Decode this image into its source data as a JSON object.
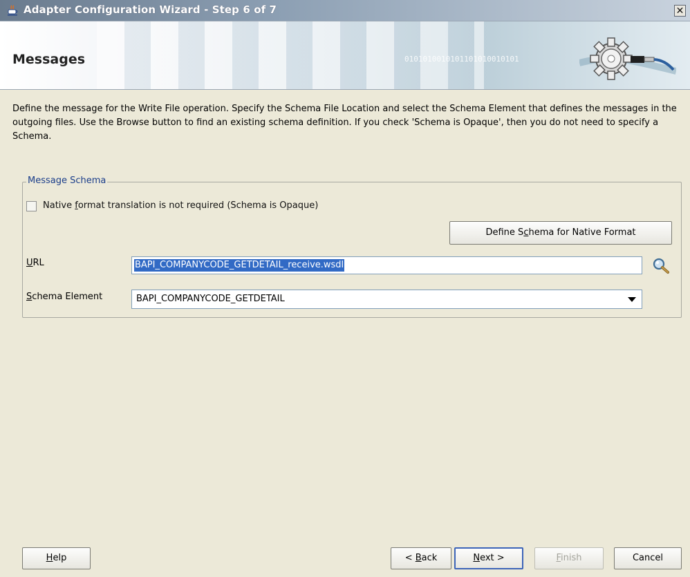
{
  "window": {
    "title": "Adapter Configuration Wizard - Step 6 of 7",
    "close_label": "✕"
  },
  "banner": {
    "heading": "Messages",
    "binary_text": "0101010010101101010010101"
  },
  "description": "Define the message for the Write File operation.  Specify the Schema File Location and select the Schema Element that defines the messages in the outgoing files. Use the Browse button to find an existing schema definition. If you check 'Schema is Opaque', then you do not need to specify a Schema.",
  "message_schema": {
    "group_title": "Message Schema",
    "opaque_checkbox": {
      "label_prefix": "Native ",
      "label_mnemonic": "f",
      "label_suffix": "ormat translation is not required (Schema is Opaque)",
      "checked": false
    },
    "define_button": {
      "label_prefix": "Define S",
      "label_mnemonic": "c",
      "label_suffix": "hema for Native Format"
    },
    "url": {
      "label_mnemonic": "U",
      "label_suffix": "RL",
      "value": "BAPI_COMPANYCODE_GETDETAIL_receive.wsdl"
    },
    "schema_element": {
      "label_mnemonic": "S",
      "label_suffix": "chema Element",
      "value": "BAPI_COMPANYCODE_GETDETAIL"
    }
  },
  "buttons": {
    "help": {
      "mnemonic": "H",
      "suffix": "elp"
    },
    "back": {
      "prefix": "< ",
      "mnemonic": "B",
      "suffix": "ack"
    },
    "next": {
      "mnemonic": "N",
      "suffix": "ext >"
    },
    "finish": {
      "mnemonic": "F",
      "suffix": "inish"
    },
    "cancel": {
      "label": "Cancel"
    }
  }
}
